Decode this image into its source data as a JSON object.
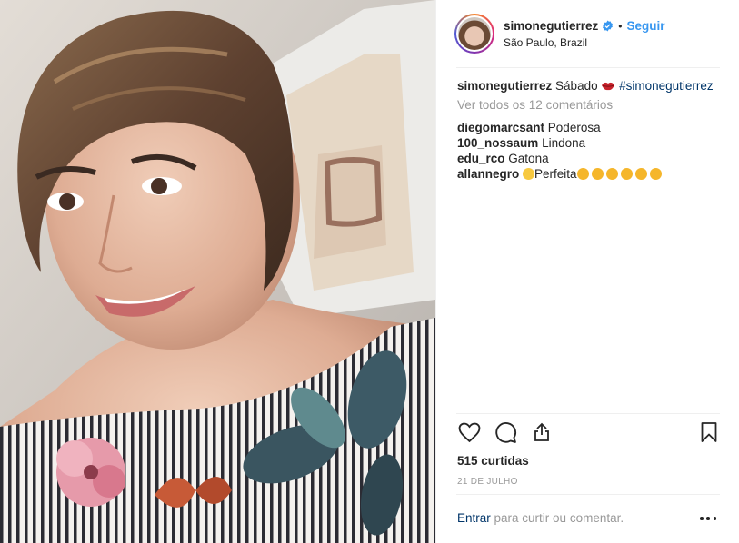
{
  "header": {
    "username": "simonegutierrez",
    "separator": "•",
    "follow_label": "Seguir",
    "location": "São Paulo, Brazil",
    "verified_icon": "verified-badge-icon",
    "accent_color": "#3897f0"
  },
  "caption": {
    "username": "simonegutierrez",
    "text": "Sábado",
    "emoji": "lips-emoji",
    "hashtag": "#simonegutierrez"
  },
  "view_all_comments": "Ver todos os 12 comentários",
  "comments": [
    {
      "username": "diegomarcsant",
      "text": "Poderosa"
    },
    {
      "username": "100_nossaum",
      "text": "Lindona"
    },
    {
      "username": "edu_rco",
      "text": "Gatona"
    },
    {
      "username": "allannegro",
      "text": "Perfeita",
      "emoji_prefix": "star-eyes-emoji",
      "emoji_suffix": "clapping-hands-emoji"
    }
  ],
  "actions": {
    "like_icon": "heart-icon",
    "comment_icon": "comment-bubble-icon",
    "share_icon": "share-icon",
    "save_icon": "bookmark-icon"
  },
  "likes": {
    "count": "515",
    "label": "curtidas"
  },
  "date": "21 DE JULHO",
  "login_bar": {
    "link": "Entrar",
    "text": "para curtir ou comentar.",
    "more_icon": "more-options-icon"
  }
}
